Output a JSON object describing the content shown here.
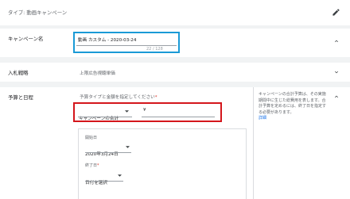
{
  "header": {
    "type_label": "タイプ: 動画キャンペーン",
    "edit_icon": "pencil-icon"
  },
  "campaign_name": {
    "section_label": "キャンペーン名",
    "value": "動画 カスタム - 2020-03-24",
    "counter": "22 / 128",
    "toggle_icon": "chevron-up-icon"
  },
  "bidding": {
    "section_label": "入札戦略",
    "value": "上限広告視聴単価",
    "toggle_icon": "chevron-down-icon"
  },
  "budget_dates": {
    "section_label": "予算と日程",
    "prompt": "予算タイプと金額を指定してください",
    "required_mark": "*",
    "budget_type": "キャンペーンの合計",
    "currency_symbol": "¥",
    "start_label": "開始日",
    "start_value": "2020年3月24日",
    "end_label": "終了日",
    "end_required": "*",
    "end_value": "日付を選択",
    "help_text": "キャンペーンの合計予算は、その実施期間中に生じた総費用を表します。合計予算を定めるには、終了日を指定する必要があります。",
    "help_link": "詳細",
    "toggle_icon": "chevron-up-icon"
  },
  "colors": {
    "highlight_blue": "#1a9ad6",
    "highlight_red": "#d4161c",
    "link": "#1a73e8",
    "required": "#d93025"
  }
}
